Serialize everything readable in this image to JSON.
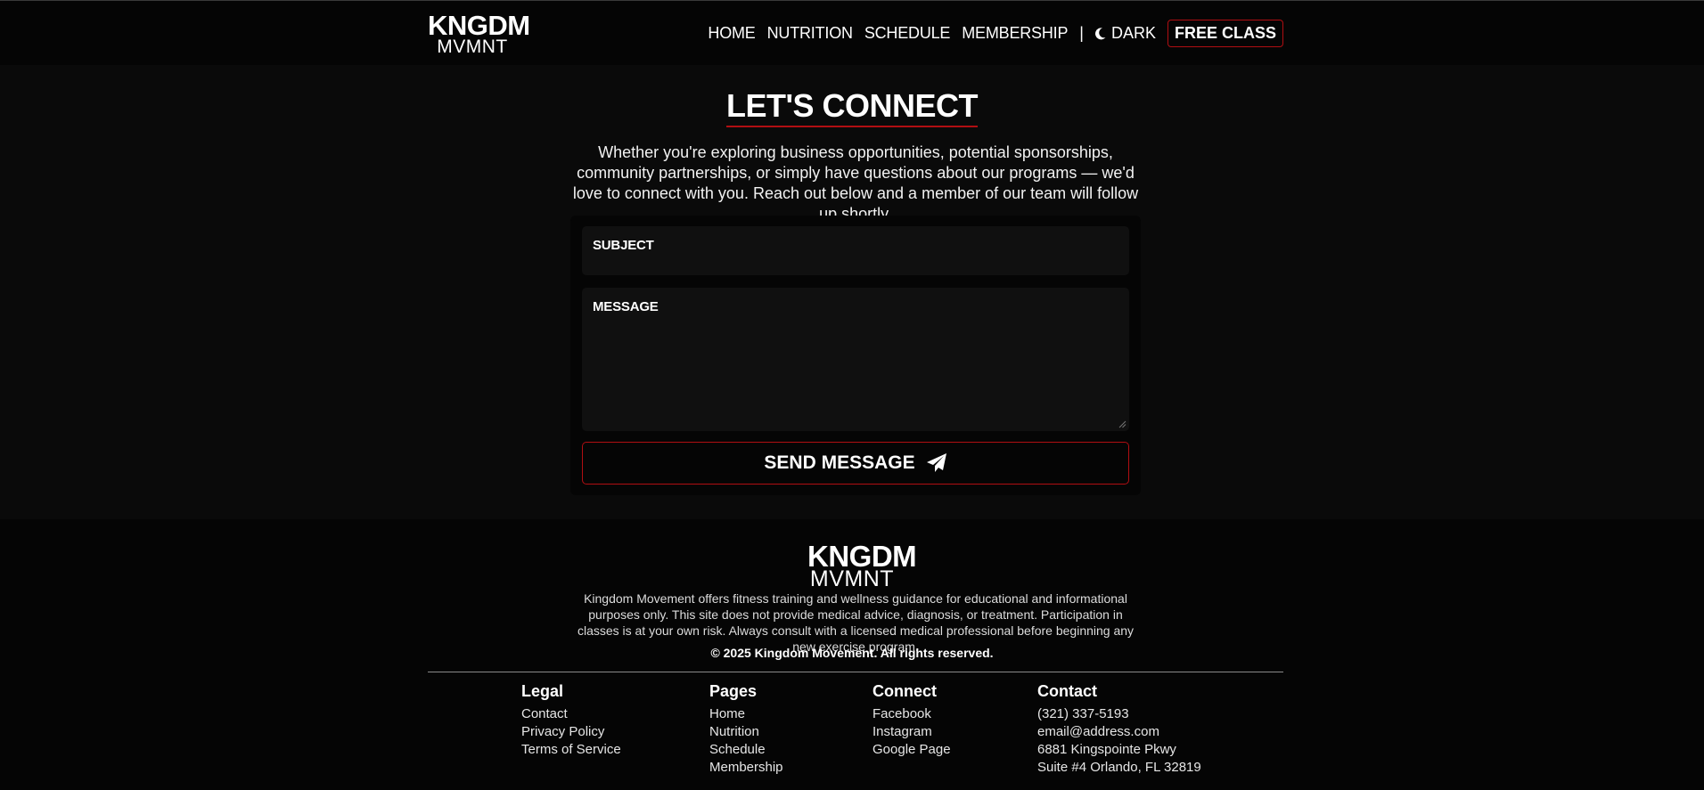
{
  "header": {
    "logo_top": "KNGDM",
    "logo_bottom": "MVMNT",
    "nav": [
      "HOME",
      "NUTRITION",
      "SCHEDULE",
      "MEMBERSHIP"
    ],
    "separator": "|",
    "theme_label": "DARK",
    "cta_label": "FREE CLASS"
  },
  "contact": {
    "title": "LET'S CONNECT",
    "intro": "Whether you're exploring business opportunities, potential sponsorships, community partnerships, or simply have questions about our programs — we'd love to connect with you. Reach out below and a member of our team will follow up shortly.",
    "subject_label": "SUBJECT",
    "message_label": "MESSAGE",
    "send_label": "SEND MESSAGE"
  },
  "footer": {
    "logo_top": "KNGDM",
    "logo_bottom": "MVMNT",
    "disclaimer": "Kingdom Movement offers fitness training and wellness guidance for educational and informational purposes only. This site does not provide medical advice, diagnosis, or treatment. Participation in classes is at your own risk. Always consult with a licensed medical professional before beginning any new exercise program.",
    "copyright": "© 2025 Kingdom Movement. All rights reserved.",
    "legal": {
      "title": "Legal",
      "links": [
        "Contact",
        "Privacy Policy",
        "Terms of Service"
      ]
    },
    "pages": {
      "title": "Pages",
      "links": [
        "Home",
        "Nutrition",
        "Schedule",
        "Membership"
      ]
    },
    "connect": {
      "title": "Connect",
      "links": [
        "Facebook",
        "Instagram",
        "Google Page"
      ]
    },
    "contact": {
      "title": "Contact",
      "lines": [
        "(321) 337-5193",
        "email@address.com",
        "6881 Kingspointe Pkwy",
        "Suite #4 Orlando, FL 32819"
      ]
    }
  },
  "colors": {
    "accent": "#b00e12",
    "background": "#0a0a0a",
    "header_bg": "#050505",
    "field_bg": "#101010"
  },
  "icons": {
    "theme": "moon-icon",
    "send": "paper-plane-icon",
    "resize": "resize-handle-icon"
  }
}
